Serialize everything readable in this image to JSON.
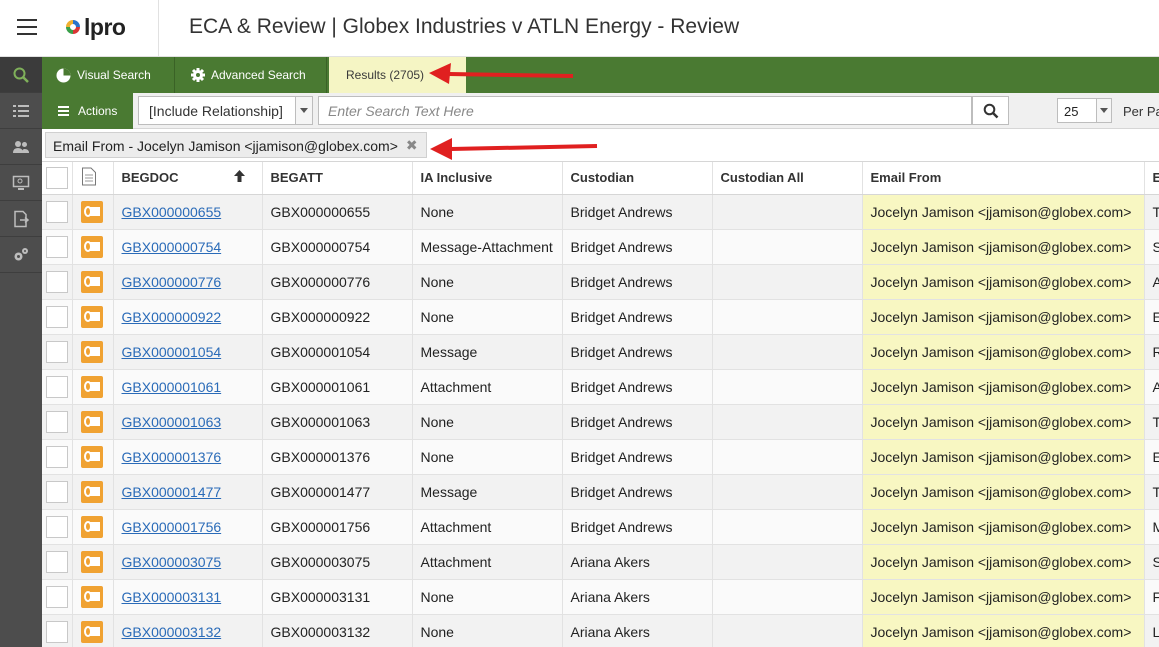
{
  "header": {
    "logo_text": "lpro",
    "title": "ECA & Review | Globex Industries v ATLN Energy - Review"
  },
  "rail": {
    "items": [
      "search-icon",
      "list-icon",
      "users-icon",
      "monitor-icon",
      "document-export-icon",
      "gears-icon"
    ]
  },
  "tabs": {
    "visual": "Visual Search",
    "advanced": "Advanced Search",
    "results": "Results (2705)"
  },
  "toolbar": {
    "actions": "Actions",
    "relationship": "[Include Relationship]",
    "search_placeholder": "Enter Search Text Here",
    "per_page_value": "25",
    "per_page_label": "Per Pa"
  },
  "filter": {
    "chip": "Email From - Jocelyn Jamison <jjamison@globex.com>",
    "close": "✖"
  },
  "table": {
    "headers": [
      "BEGDOC",
      "BEGATT",
      "IA Inclusive",
      "Custodian",
      "Custodian All",
      "Email From",
      "E"
    ],
    "rows": [
      {
        "begdoc": "GBX000000655",
        "begatt": "GBX000000655",
        "ia": "None",
        "custodian": "Bridget Andrews",
        "custodian_all": "",
        "email_from": "Jocelyn Jamison <jjamison@globex.com>",
        "next": "T"
      },
      {
        "begdoc": "GBX000000754",
        "begatt": "GBX000000754",
        "ia": "Message-Attachment",
        "custodian": "Bridget Andrews",
        "custodian_all": "",
        "email_from": "Jocelyn Jamison <jjamison@globex.com>",
        "next": "S"
      },
      {
        "begdoc": "GBX000000776",
        "begatt": "GBX000000776",
        "ia": "None",
        "custodian": "Bridget Andrews",
        "custodian_all": "",
        "email_from": "Jocelyn Jamison <jjamison@globex.com>",
        "next": "A"
      },
      {
        "begdoc": "GBX000000922",
        "begatt": "GBX000000922",
        "ia": "None",
        "custodian": "Bridget Andrews",
        "custodian_all": "",
        "email_from": "Jocelyn Jamison <jjamison@globex.com>",
        "next": "E"
      },
      {
        "begdoc": "GBX000001054",
        "begatt": "GBX000001054",
        "ia": "Message",
        "custodian": "Bridget Andrews",
        "custodian_all": "",
        "email_from": "Jocelyn Jamison <jjamison@globex.com>",
        "next": "R"
      },
      {
        "begdoc": "GBX000001061",
        "begatt": "GBX000001061",
        "ia": "Attachment",
        "custodian": "Bridget Andrews",
        "custodian_all": "",
        "email_from": "Jocelyn Jamison <jjamison@globex.com>",
        "next": "A"
      },
      {
        "begdoc": "GBX000001063",
        "begatt": "GBX000001063",
        "ia": "None",
        "custodian": "Bridget Andrews",
        "custodian_all": "",
        "email_from": "Jocelyn Jamison <jjamison@globex.com>",
        "next": "T"
      },
      {
        "begdoc": "GBX000001376",
        "begatt": "GBX000001376",
        "ia": "None",
        "custodian": "Bridget Andrews",
        "custodian_all": "",
        "email_from": "Jocelyn Jamison <jjamison@globex.com>",
        "next": "E"
      },
      {
        "begdoc": "GBX000001477",
        "begatt": "GBX000001477",
        "ia": "Message",
        "custodian": "Bridget Andrews",
        "custodian_all": "",
        "email_from": "Jocelyn Jamison <jjamison@globex.com>",
        "next": "T"
      },
      {
        "begdoc": "GBX000001756",
        "begatt": "GBX000001756",
        "ia": "Attachment",
        "custodian": "Bridget Andrews",
        "custodian_all": "",
        "email_from": "Jocelyn Jamison <jjamison@globex.com>",
        "next": "M"
      },
      {
        "begdoc": "GBX000003075",
        "begatt": "GBX000003075",
        "ia": "Attachment",
        "custodian": "Ariana Akers",
        "custodian_all": "",
        "email_from": "Jocelyn Jamison <jjamison@globex.com>",
        "next": "S"
      },
      {
        "begdoc": "GBX000003131",
        "begatt": "GBX000003131",
        "ia": "None",
        "custodian": "Ariana Akers",
        "custodian_all": "",
        "email_from": "Jocelyn Jamison <jjamison@globex.com>",
        "next": "F"
      },
      {
        "begdoc": "GBX000003132",
        "begatt": "GBX000003132",
        "ia": "None",
        "custodian": "Ariana Akers",
        "custodian_all": "",
        "email_from": "Jocelyn Jamison <jjamison@globex.com>",
        "next": "L"
      }
    ]
  },
  "colors": {
    "brand_green": "#4a7a32",
    "results_tab": "#f5f5c4",
    "highlight": "#f8f7c2",
    "link": "#2a6bb8",
    "annotation_red": "#e02020"
  }
}
